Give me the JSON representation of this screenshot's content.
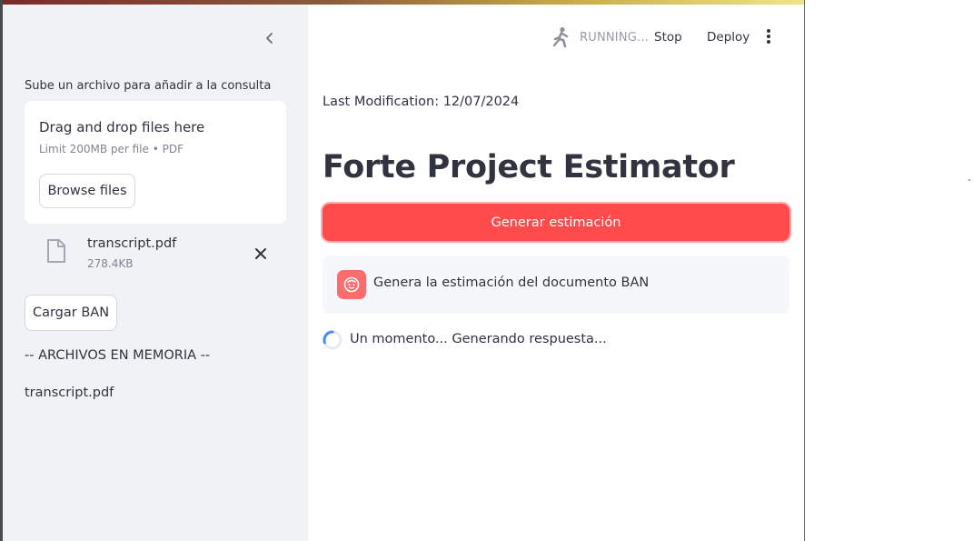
{
  "sidebar": {
    "upload_label": "Sube un archivo para añadir a la consulta",
    "dropzone": {
      "title": "Drag and drop files here",
      "limit": "Limit 200MB per file • PDF",
      "browse_label": "Browse files"
    },
    "uploaded_file": {
      "name": "transcript.pdf",
      "size": "278.4KB",
      "icon": "file-icon"
    },
    "cargar_label": "Cargar BAN",
    "memory_title": "-- ARCHIVOS EN MEMORIA --",
    "memory_files": [
      "transcript.pdf"
    ]
  },
  "toolbar": {
    "status": "RUNNING...",
    "stop_label": "Stop",
    "deploy_label": "Deploy",
    "menu_icon": "kebab-menu-icon"
  },
  "main": {
    "last_modification": "Last Modification: 12/07/2024",
    "title": "Forte Project Estimator",
    "primary_button": "Generar estimación",
    "chat_message": "Genera la estimación del documento BAN",
    "spinner_text": "Un momento... Generando respuesta..."
  },
  "colors": {
    "primary": "#ff4b4b",
    "sidebar_bg": "#f0f2f6",
    "text": "#31333f",
    "muted": "#808495"
  }
}
